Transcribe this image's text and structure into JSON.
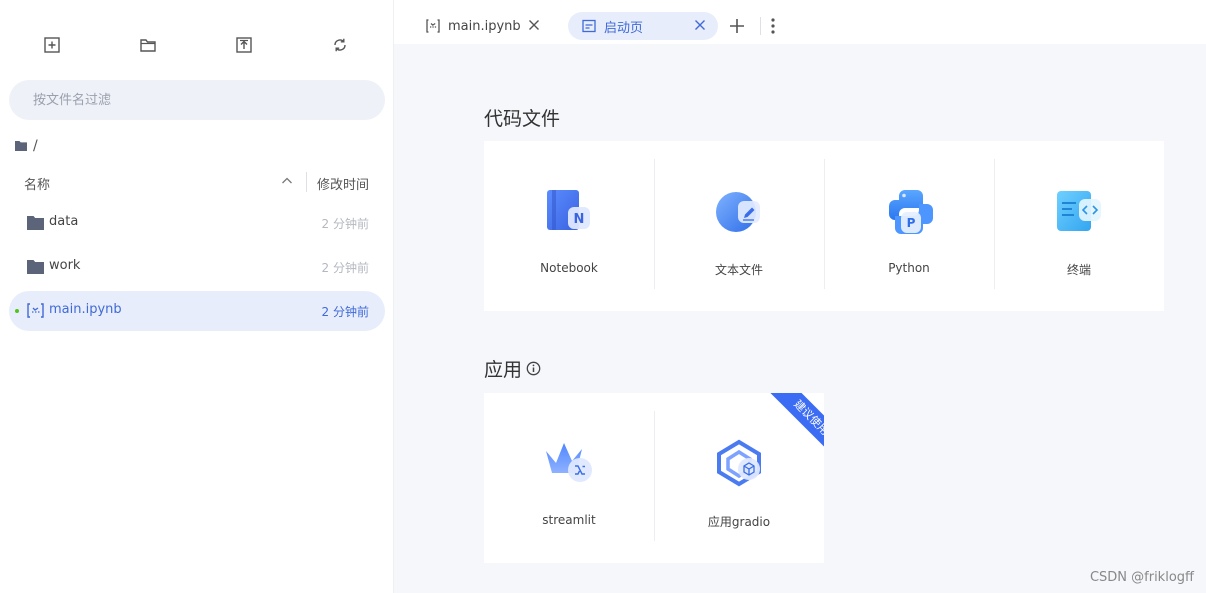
{
  "sidebar": {
    "toolbar": [
      {
        "name": "new-launcher-button",
        "icon": "plus-square-icon"
      },
      {
        "name": "new-folder-button",
        "icon": "folder-icon"
      },
      {
        "name": "upload-button",
        "icon": "upload-icon"
      },
      {
        "name": "refresh-button",
        "icon": "refresh-icon"
      }
    ],
    "search_placeholder": "按文件名过滤",
    "breadcrumb": "/",
    "columns": {
      "name": "名称",
      "modified": "修改时间"
    },
    "files": [
      {
        "name": "data",
        "type": "folder",
        "modified": "2 分钟前"
      },
      {
        "name": "work",
        "type": "folder",
        "modified": "2 分钟前"
      },
      {
        "name": "main.ipynb",
        "type": "notebook",
        "modified": "2 分钟前"
      }
    ]
  },
  "tabs": [
    {
      "label": "main.ipynb",
      "icon": "notebook-icon"
    },
    {
      "label": "启动页",
      "icon": "launcher-icon"
    }
  ],
  "main": {
    "code_section": {
      "title": "代码文件",
      "items": [
        {
          "label": "Notebook",
          "icon": "notebook-icon"
        },
        {
          "label": "文本文件",
          "icon": "text-file-icon"
        },
        {
          "label": "Python",
          "icon": "python-icon"
        },
        {
          "label": "终端",
          "icon": "terminal-icon"
        }
      ]
    },
    "app_section": {
      "title": "应用",
      "items": [
        {
          "label": "streamlit",
          "icon": "streamlit-icon"
        },
        {
          "label": "应用gradio",
          "icon": "gradio-icon",
          "ribbon": "建议使用"
        }
      ]
    }
  },
  "watermark": "CSDN @friklogff",
  "colors": {
    "accent": "#3f6ad8",
    "active_bg": "#e8edfb",
    "ribbon": "#3b6cf3"
  }
}
